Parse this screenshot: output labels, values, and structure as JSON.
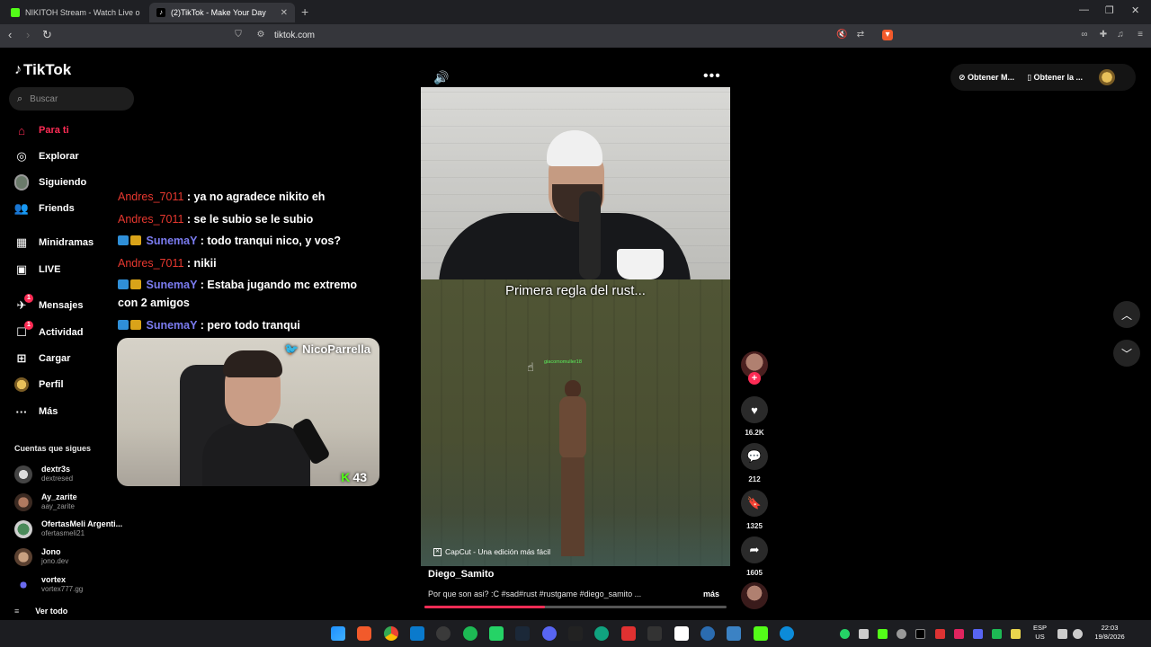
{
  "browser": {
    "tabs": [
      {
        "title": "NIKITOH Stream - Watch Live on"
      },
      {
        "title": "(2)TikTok - Make Your Day",
        "close": "✕"
      }
    ],
    "new_tab": "+",
    "url": "tiktok.com"
  },
  "sidebar": {
    "logo": "TikTok",
    "search_placeholder": "Buscar",
    "nav": [
      {
        "label": "Para ti",
        "icon": "home-icon",
        "active": true
      },
      {
        "label": "Explorar",
        "icon": "compass-icon"
      },
      {
        "label": "Siguiendo",
        "icon": "following-avatar-icon"
      },
      {
        "label": "Friends",
        "icon": "friends-icon"
      },
      {
        "label": "Minidramas",
        "icon": "film-icon"
      },
      {
        "label": "LIVE",
        "icon": "live-tv-icon"
      },
      {
        "label": "Mensajes",
        "icon": "messages-icon",
        "badge": "1"
      },
      {
        "label": "Actividad",
        "icon": "activity-icon",
        "badge": "1"
      },
      {
        "label": "Cargar",
        "icon": "upload-icon"
      },
      {
        "label": "Perfil",
        "icon": "profile-avatar-icon"
      },
      {
        "label": "Más",
        "icon": "more-dots-icon"
      }
    ],
    "following_title": "Cuentas que sigues",
    "following": [
      {
        "name": "dextr3s",
        "handle": "dextresed"
      },
      {
        "name": "Ay_zarite",
        "handle": "aay_zarite"
      },
      {
        "name": "OfertasMeli Argenti...",
        "handle": "ofertasmeli21"
      },
      {
        "name": "Jono",
        "handle": "jono.dev"
      },
      {
        "name": "vortex",
        "handle": "vortex777.gg"
      }
    ],
    "see_all": "Ver todo"
  },
  "stream_overlay": {
    "chat": [
      {
        "user": "Andres_7011",
        "msg": ": ya no agradece nikito eh",
        "color": "red"
      },
      {
        "user": "Andres_7011",
        "msg": ": se le subio se le subio",
        "color": "red"
      },
      {
        "user": "SunemaY",
        "msg": ": todo tranqui nico, y vos?",
        "color": "blue"
      },
      {
        "user": "Andres_7011",
        "msg": ": nikii",
        "color": "red"
      },
      {
        "user": "SunemaY",
        "msg": ": Estaba jugando mc extremo con 2 amigos",
        "color": "blue"
      },
      {
        "user": "SunemaY",
        "msg": ": pero todo tranqui",
        "color": "blue"
      }
    ],
    "cam_handle": "NicoParrella",
    "viewer_count": "43"
  },
  "video": {
    "subtitle": "Primera regla del rust...",
    "player_tag": "giacomomuller18",
    "watermark": "CapCut - Una edición más fácil",
    "author": "Diego_Samito",
    "description": "Por que son asi? :C #sad#rust #rustgame #diego_samito ...",
    "more": "más",
    "progress": 0.4,
    "likes": "16.2K",
    "comments": "212",
    "saves": "1325",
    "shares": "1605"
  },
  "header_right": {
    "btn1": "Obtener M...",
    "btn2": "Obtener la ..."
  },
  "taskbar": {
    "lang": "ESP",
    "region": "US",
    "time": "22:03",
    "date": "19/8/2026"
  }
}
